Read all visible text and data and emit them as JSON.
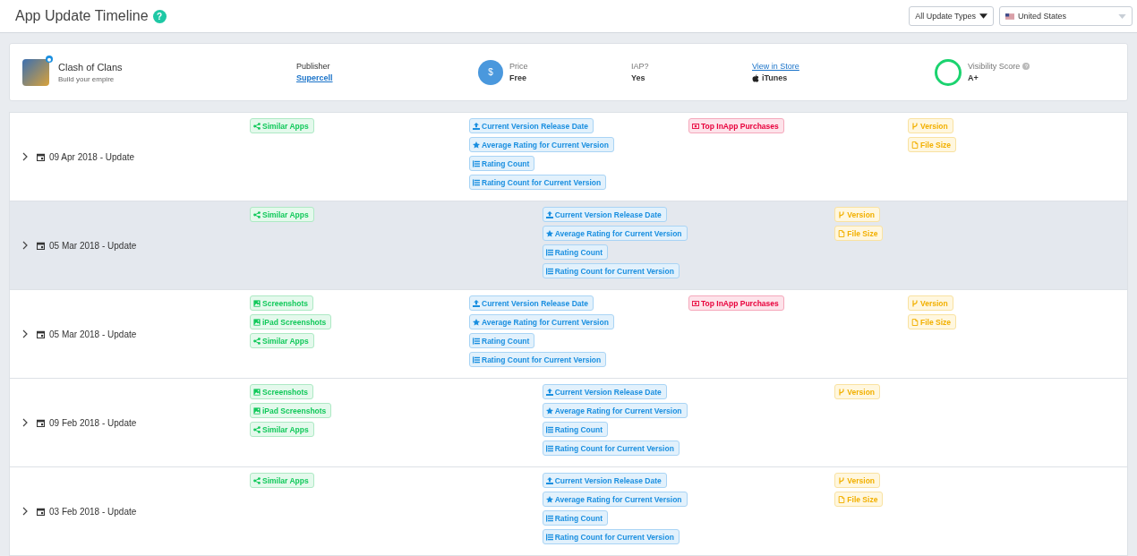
{
  "header": {
    "title": "App Update Timeline",
    "help": "?",
    "type_filter": "All Update Types",
    "country": "United States"
  },
  "app": {
    "name": "Clash of Clans",
    "subtitle": "Build your empire",
    "publisher_label": "Publisher",
    "publisher": "Supercell",
    "price_icon": "$",
    "price_label": "Price",
    "price": "Free",
    "iap_label": "IAP?",
    "iap": "Yes",
    "store_link": "View in Store",
    "store": "iTunes",
    "score_label": "Visibility Score",
    "score_help": "?",
    "score": "A+"
  },
  "updates": [
    {
      "date": "09 Apr 2018 - Update",
      "selected": false,
      "groups": [
        {
          "kind": "media",
          "tags": [
            {
              "kind": "share",
              "label": "Similar Apps"
            }
          ]
        },
        {
          "kind": "rating",
          "tags": [
            {
              "kind": "upload",
              "label": "Current Version Release Date"
            },
            {
              "kind": "star",
              "label": "Average Rating for Current Version"
            },
            {
              "kind": "list",
              "label": "Rating Count"
            },
            {
              "kind": "list",
              "label": "Rating Count for Current Version"
            }
          ]
        },
        {
          "kind": "iap",
          "tags": [
            {
              "kind": "money",
              "label": "Top InApp Purchases"
            }
          ]
        },
        {
          "kind": "meta",
          "tags": [
            {
              "kind": "branch",
              "label": "Version"
            },
            {
              "kind": "file",
              "label": "File Size"
            }
          ]
        }
      ]
    },
    {
      "date": "05 Mar 2018 - Update",
      "selected": true,
      "groups": [
        {
          "kind": "media",
          "tags": [
            {
              "kind": "share",
              "label": "Similar Apps"
            }
          ]
        },
        {
          "kind": "rating",
          "tags": [
            {
              "kind": "upload",
              "label": "Current Version Release Date"
            },
            {
              "kind": "star",
              "label": "Average Rating for Current Version"
            },
            {
              "kind": "list",
              "label": "Rating Count"
            },
            {
              "kind": "list",
              "label": "Rating Count for Current Version"
            }
          ]
        },
        {
          "kind": "meta",
          "tags": [
            {
              "kind": "branch",
              "label": "Version"
            },
            {
              "kind": "file",
              "label": "File Size"
            }
          ]
        }
      ]
    },
    {
      "date": "05 Mar 2018 - Update",
      "selected": false,
      "groups": [
        {
          "kind": "media",
          "tags": [
            {
              "kind": "image",
              "label": "Screenshots"
            },
            {
              "kind": "image",
              "label": "iPad Screenshots"
            },
            {
              "kind": "share",
              "label": "Similar Apps"
            }
          ]
        },
        {
          "kind": "rating",
          "tags": [
            {
              "kind": "upload",
              "label": "Current Version Release Date"
            },
            {
              "kind": "star",
              "label": "Average Rating for Current Version"
            },
            {
              "kind": "list",
              "label": "Rating Count"
            },
            {
              "kind": "list",
              "label": "Rating Count for Current Version"
            }
          ]
        },
        {
          "kind": "iap",
          "tags": [
            {
              "kind": "money",
              "label": "Top InApp Purchases"
            }
          ]
        },
        {
          "kind": "meta",
          "tags": [
            {
              "kind": "branch",
              "label": "Version"
            },
            {
              "kind": "file",
              "label": "File Size"
            }
          ]
        }
      ]
    },
    {
      "date": "09 Feb 2018 - Update",
      "selected": false,
      "groups": [
        {
          "kind": "media",
          "tags": [
            {
              "kind": "image",
              "label": "Screenshots"
            },
            {
              "kind": "image",
              "label": "iPad Screenshots"
            },
            {
              "kind": "share",
              "label": "Similar Apps"
            }
          ]
        },
        {
          "kind": "rating",
          "tags": [
            {
              "kind": "upload",
              "label": "Current Version Release Date"
            },
            {
              "kind": "star",
              "label": "Average Rating for Current Version"
            },
            {
              "kind": "list",
              "label": "Rating Count"
            },
            {
              "kind": "list",
              "label": "Rating Count for Current Version"
            }
          ]
        },
        {
          "kind": "meta",
          "tags": [
            {
              "kind": "branch",
              "label": "Version"
            }
          ]
        }
      ]
    },
    {
      "date": "03 Feb 2018 - Update",
      "selected": false,
      "groups": [
        {
          "kind": "media",
          "tags": [
            {
              "kind": "share",
              "label": "Similar Apps"
            }
          ]
        },
        {
          "kind": "rating",
          "tags": [
            {
              "kind": "upload",
              "label": "Current Version Release Date"
            },
            {
              "kind": "star",
              "label": "Average Rating for Current Version"
            },
            {
              "kind": "list",
              "label": "Rating Count"
            },
            {
              "kind": "list",
              "label": "Rating Count for Current Version"
            }
          ]
        },
        {
          "kind": "meta",
          "tags": [
            {
              "kind": "branch",
              "label": "Version"
            },
            {
              "kind": "file",
              "label": "File Size"
            }
          ]
        }
      ]
    }
  ]
}
